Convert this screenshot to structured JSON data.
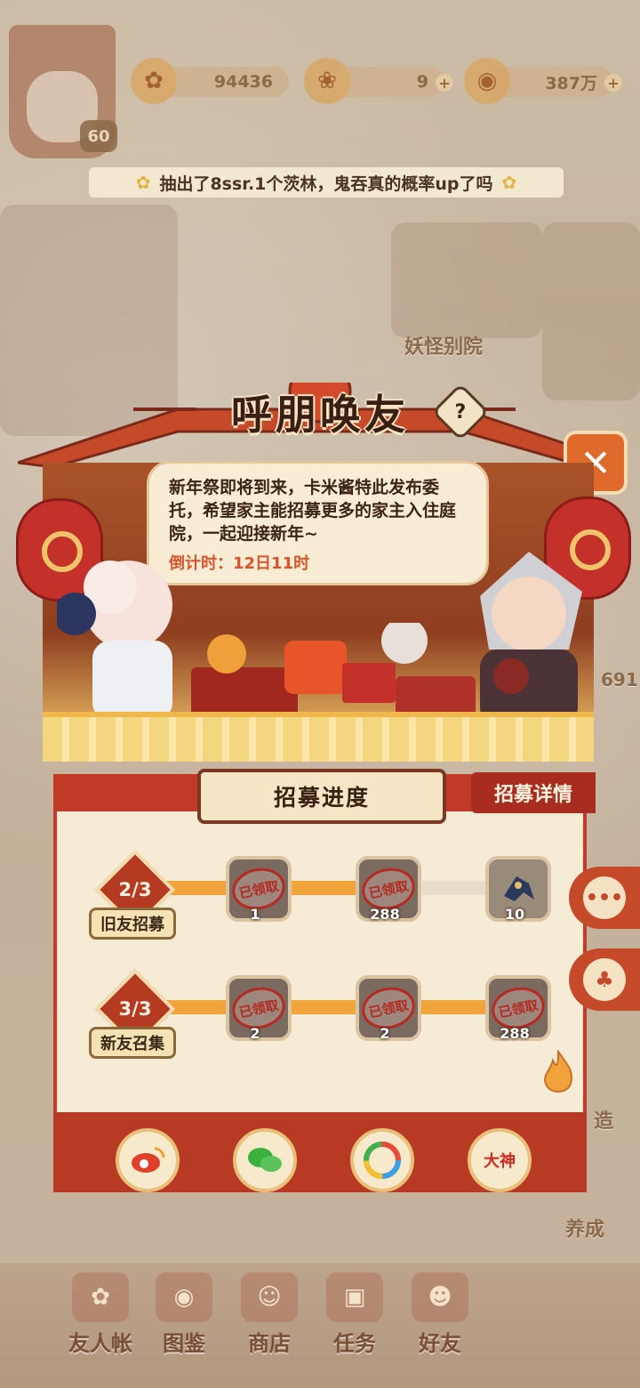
{
  "hud": {
    "level": "60",
    "resources": [
      {
        "value": "94436",
        "icon": "gold-flower-icon"
      },
      {
        "value": "9",
        "icon": "fish-icon"
      },
      {
        "value": "387万",
        "icon": "coin-icon"
      }
    ]
  },
  "ticker": {
    "text": "抽出了8ssr.1个茨林，鬼吞真的概率up了吗"
  },
  "background": {
    "building_label": "妖怪别院",
    "side_labels": [
      "造",
      "养成"
    ],
    "side_number": "691"
  },
  "panel": {
    "title": "呼朋唤友",
    "help": "?",
    "message": "新年祭即将到来，卡米酱特此发布委托，希望家主能招募更多的家主入住庭院，一起迎接新年~",
    "countdown": "倒计时：12日11时",
    "progress_title": "招募进度",
    "detail_button": "招募详情"
  },
  "tracks": [
    {
      "label": "旧友招募",
      "count": "2/3",
      "progress": 0.67,
      "rewards": [
        {
          "qty": "1",
          "claimed": true,
          "stamp": "已领取"
        },
        {
          "qty": "288",
          "claimed": true,
          "stamp": "已领取"
        },
        {
          "qty": "10",
          "claimed": false,
          "icon": "bird-icon"
        }
      ]
    },
    {
      "label": "新友召集",
      "count": "3/3",
      "progress": 1.0,
      "rewards": [
        {
          "qty": "2",
          "claimed": true,
          "stamp": "已领取"
        },
        {
          "qty": "2",
          "claimed": true,
          "stamp": "已领取"
        },
        {
          "qty": "288",
          "claimed": true,
          "stamp": "已领取"
        }
      ]
    }
  ],
  "share": [
    {
      "name": "weibo",
      "icon": "weibo-icon"
    },
    {
      "name": "wechat",
      "icon": "wechat-icon"
    },
    {
      "name": "moments",
      "icon": "moments-icon"
    },
    {
      "name": "dashen",
      "label": "大神"
    }
  ],
  "bottom_nav": [
    {
      "label": "友人帐",
      "icon": "book-icon"
    },
    {
      "label": "图鉴",
      "icon": "eye-icon"
    },
    {
      "label": "商店",
      "icon": "cat-icon"
    },
    {
      "label": "任务",
      "icon": "gift-icon"
    },
    {
      "label": "好友",
      "icon": "friends-icon"
    }
  ]
}
